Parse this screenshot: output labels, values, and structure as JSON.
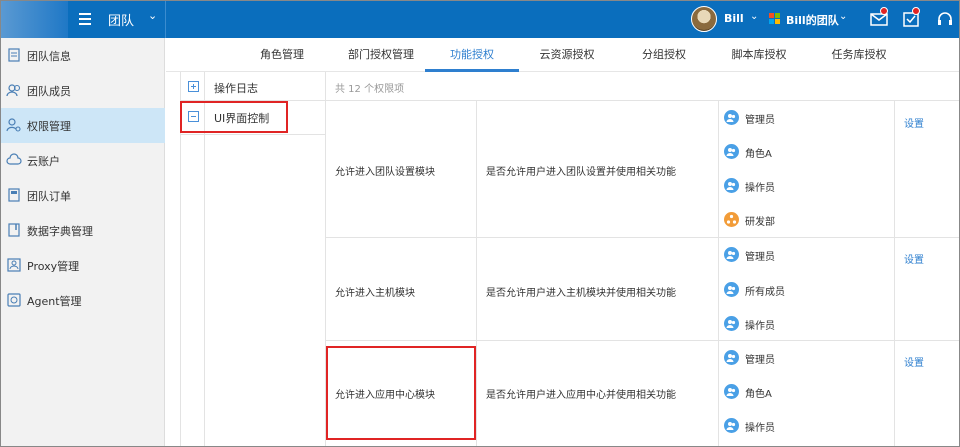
{
  "header": {
    "team_title": "团队",
    "user_name": "Bill",
    "org_name": "Bill的团队",
    "icons": [
      "menu-icon",
      "mail-icon",
      "check-icon",
      "headset-icon"
    ]
  },
  "sidebar": {
    "items": [
      {
        "label": "团队信息",
        "icon": "info-doc-icon"
      },
      {
        "label": "团队成员",
        "icon": "users-icon"
      },
      {
        "label": "权限管理",
        "icon": "user-key-icon",
        "active": true
      },
      {
        "label": "云账户",
        "icon": "cloud-icon"
      },
      {
        "label": "团队订单",
        "icon": "order-icon"
      },
      {
        "label": "数据字典管理",
        "icon": "book-icon"
      },
      {
        "label": "Proxy管理",
        "icon": "proxy-icon"
      },
      {
        "label": "Agent管理",
        "icon": "agent-icon"
      }
    ]
  },
  "tabs": [
    {
      "label": "角色管理"
    },
    {
      "label": "部门授权管理"
    },
    {
      "label": "功能授权",
      "active": true
    },
    {
      "label": "云资源授权"
    },
    {
      "label": "分组授权"
    },
    {
      "label": "脚本库授权"
    },
    {
      "label": "任务库授权"
    }
  ],
  "tree": [
    {
      "label": "操作日志",
      "expanded": false
    },
    {
      "label": "UI界面控制",
      "expanded": true
    }
  ],
  "permissions": {
    "count_text": "共 12 个权限项",
    "set_label": "设置",
    "rows": [
      {
        "name": "允许进入团队设置模块",
        "description": "是否允许用户进入团队设置并使用相关功能",
        "roles": [
          {
            "label": "管理员",
            "type": "role"
          },
          {
            "label": "角色A",
            "type": "role"
          },
          {
            "label": "操作员",
            "type": "role"
          },
          {
            "label": "研发部",
            "type": "department"
          }
        ]
      },
      {
        "name": "允许进入主机模块",
        "description": "是否允许用户进入主机模块并使用相关功能",
        "roles": [
          {
            "label": "管理员",
            "type": "role"
          },
          {
            "label": "所有成员",
            "type": "role"
          },
          {
            "label": "操作员",
            "type": "role"
          }
        ]
      },
      {
        "name": "允许进入应用中心模块",
        "description": "是否允许用户进入应用中心并使用相关功能",
        "roles": [
          {
            "label": "管理员",
            "type": "role"
          },
          {
            "label": "角色A",
            "type": "role"
          },
          {
            "label": "操作员",
            "type": "role"
          }
        ]
      }
    ]
  },
  "colors": {
    "topbar": "#0a6ebd",
    "accent": "#2e7fcf",
    "highlight": "#e02424",
    "active_sidebar": "#cde6f7"
  }
}
